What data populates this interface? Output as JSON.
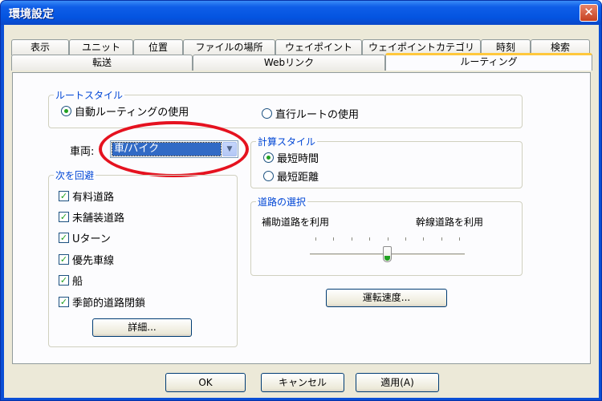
{
  "window": {
    "title": "環境設定",
    "close_symbol": "✕"
  },
  "tabs": {
    "row1": [
      "表示",
      "ユニット",
      "位置",
      "ファイルの場所",
      "ウェイポイント",
      "ウェイポイントカテゴリ",
      "時刻",
      "検索"
    ],
    "row2": [
      "転送",
      "Webリンク",
      "ルーティング"
    ],
    "active": "ルーティング"
  },
  "route_style": {
    "legend": "ルートスタイル",
    "options": [
      "自動ルーティングの使用",
      "直行ルートの使用"
    ],
    "selected": "自動ルーティングの使用"
  },
  "vehicle": {
    "label": "車両:",
    "value": "車/バイク",
    "arrow": "▼"
  },
  "calc_style": {
    "legend": "計算スタイル",
    "options": [
      "最短時間",
      "最短距離"
    ],
    "selected": "最短時間"
  },
  "avoid": {
    "legend": "次を回避",
    "items": [
      {
        "label": "有料道路",
        "checked": true
      },
      {
        "label": "未舗装道路",
        "checked": true
      },
      {
        "label": "Uターン",
        "checked": true
      },
      {
        "label": "優先車線",
        "checked": true
      },
      {
        "label": "船",
        "checked": true
      },
      {
        "label": "季節的道路閉鎖",
        "checked": true
      }
    ],
    "details_button": "詳細..."
  },
  "road_selection": {
    "legend": "道路の選択",
    "left_label": "補助道路を利用",
    "right_label": "幹線道路を利用",
    "position": 0.5,
    "ticks": 9
  },
  "speed_button": "運転速度...",
  "footer": {
    "ok": "OK",
    "cancel": "キャンセル",
    "apply": "適用(A)"
  },
  "colors": {
    "title_bar": "#0054e3",
    "legend_text": "#0046d5",
    "check_green": "#21a121",
    "highlight_ring": "#e5121f",
    "active_tab_top": "#ffc83c"
  }
}
